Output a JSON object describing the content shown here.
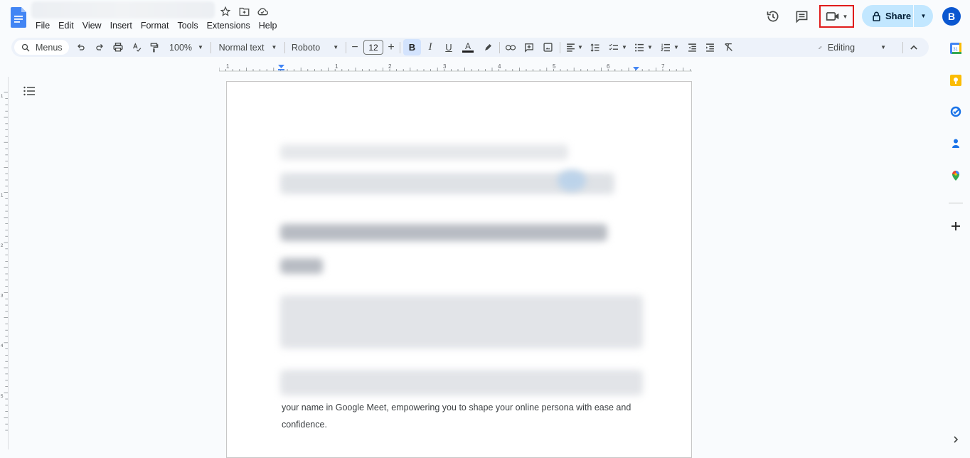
{
  "app": {
    "name": "Google Docs",
    "document_title": ""
  },
  "title_icons": [
    "star-icon",
    "move-to-folder-icon",
    "cloud-saved-icon"
  ],
  "menu": [
    "File",
    "Edit",
    "View",
    "Insert",
    "Format",
    "Tools",
    "Extensions",
    "Help"
  ],
  "header_actions": {
    "version_history": "history-icon",
    "comments": "comments-icon",
    "meet": "video-camera-icon",
    "share_label": "Share",
    "avatar_initial": "B",
    "highlighted": "meet-button"
  },
  "toolbar": {
    "search_menus": "Menus",
    "zoom": "100%",
    "style": "Normal text",
    "font": "Roboto",
    "font_size": "12",
    "bold": "B",
    "italic": "I",
    "underline": "U",
    "text_color": "A",
    "mode": "Editing"
  },
  "ruler": {
    "horizontal_labels": [
      "1",
      "1",
      "2",
      "3",
      "4",
      "5",
      "6",
      "7"
    ],
    "vertical_labels": [
      "1",
      "1",
      "2",
      "3",
      "4",
      "5"
    ]
  },
  "document": {
    "visible_lines": [
      "your name in Google Meet, empowering you to shape your online persona with ease and",
      "confidence."
    ],
    "blurred_content": true
  },
  "side_panel": [
    "calendar-icon",
    "keep-icon",
    "tasks-icon",
    "contacts-icon",
    "maps-icon",
    "add-icon"
  ],
  "colors": {
    "accent": "#0b57d0",
    "share_bg": "#c2e7ff",
    "highlight_box": "#e01b1b",
    "toolbar_bg": "#edf2fa"
  }
}
